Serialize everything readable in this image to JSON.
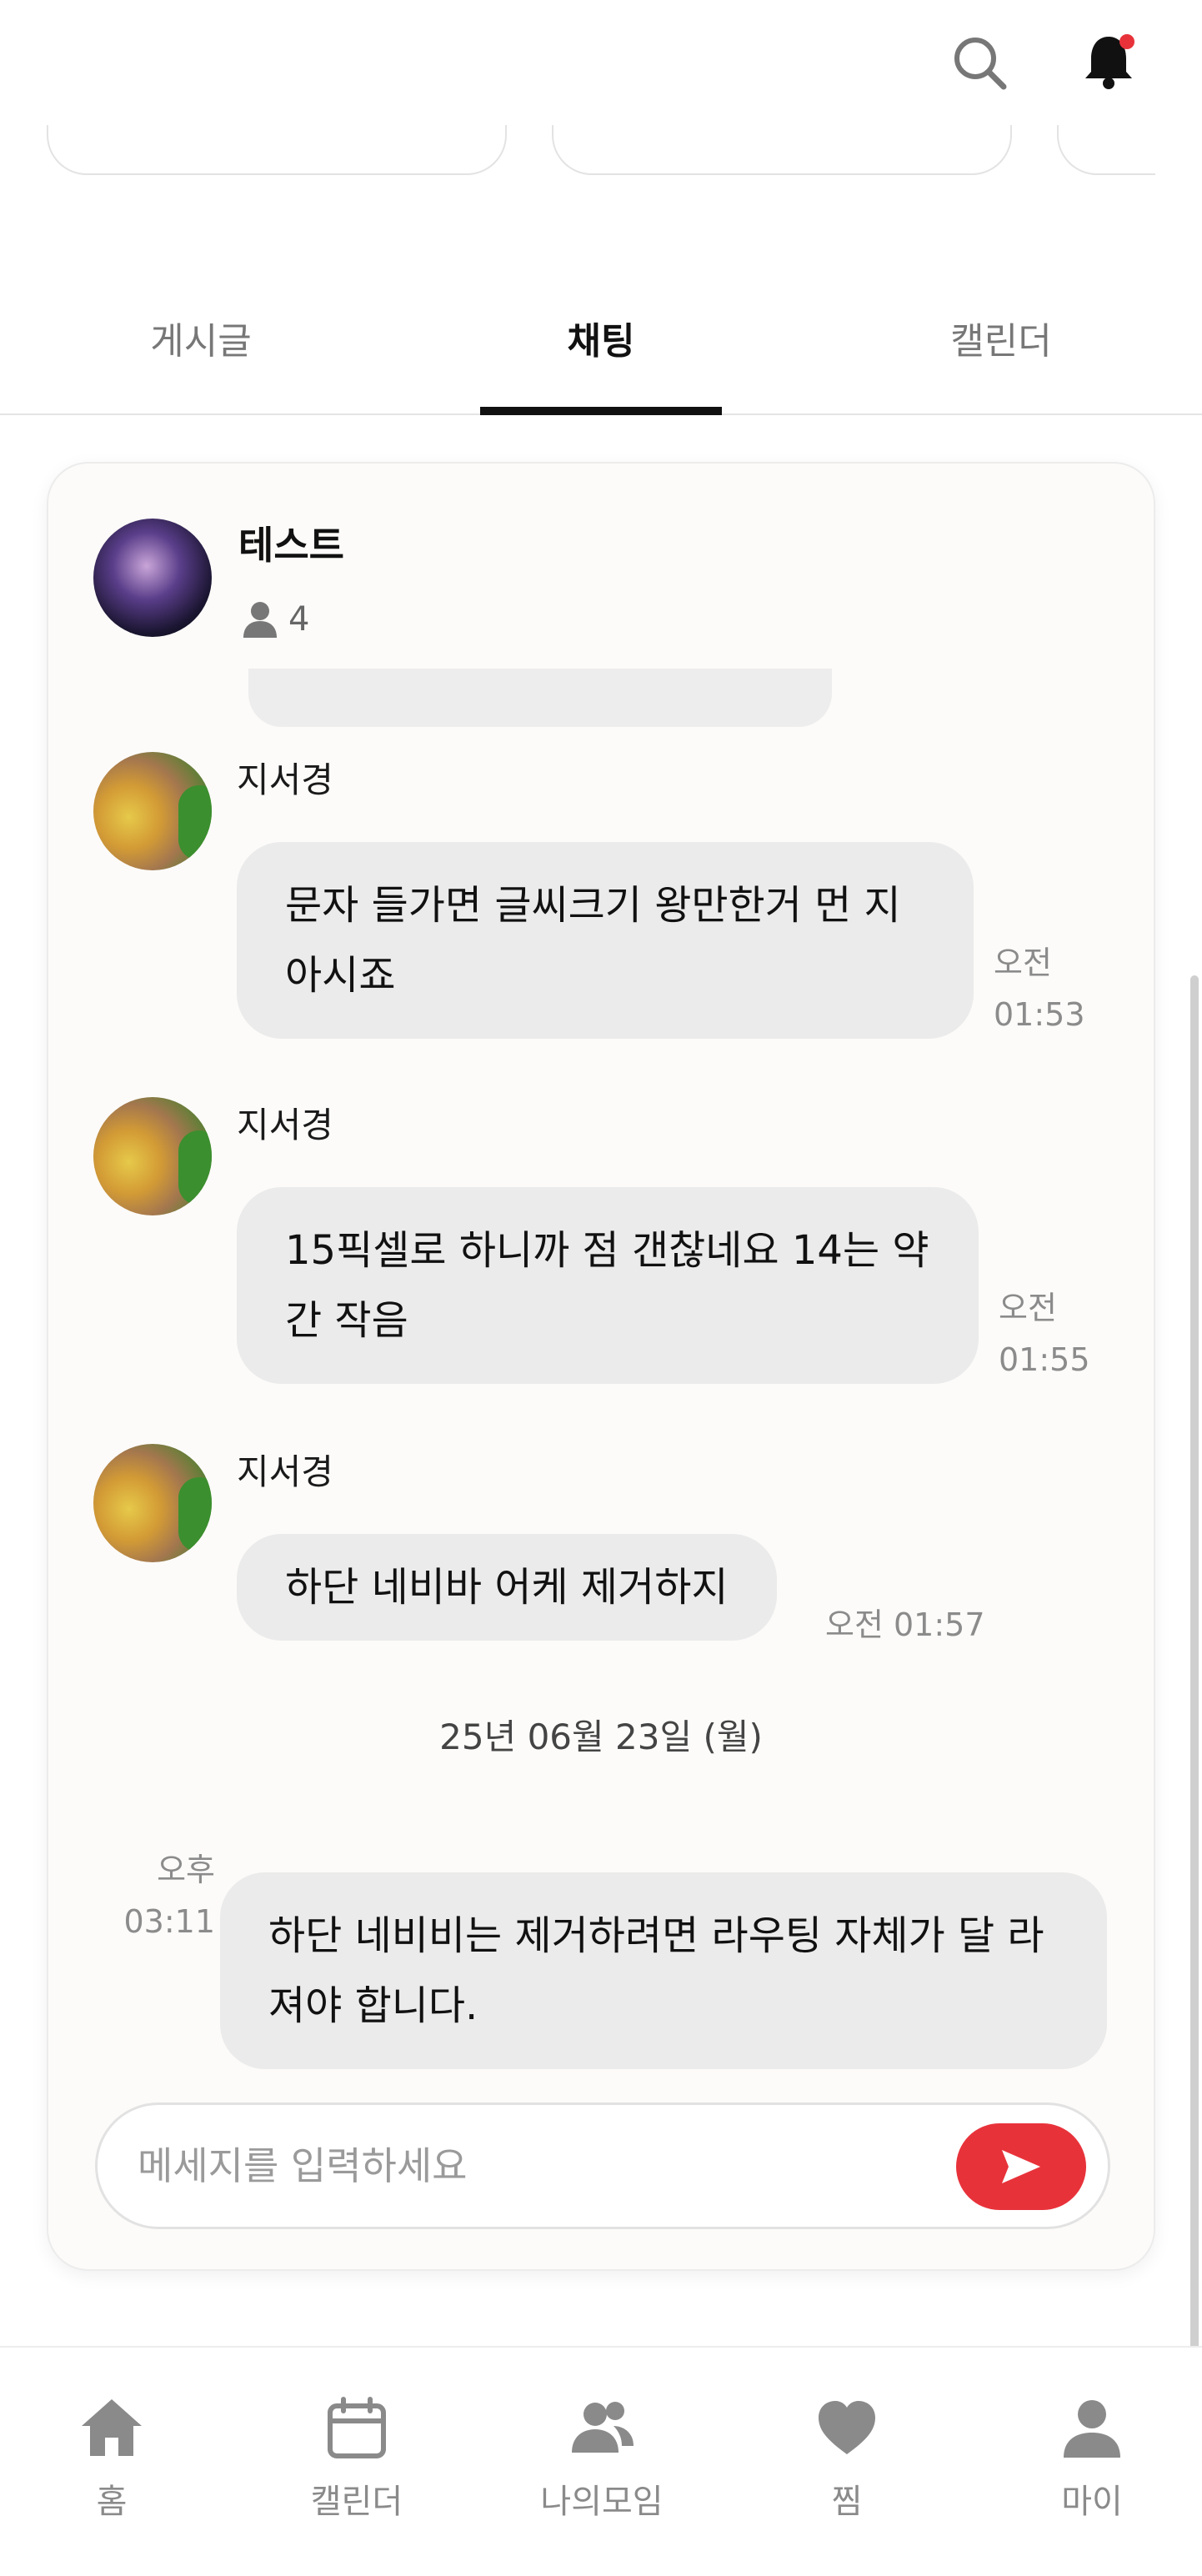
{
  "tabs": [
    {
      "label": "게시글"
    },
    {
      "label": "채팅"
    },
    {
      "label": "캘린더"
    }
  ],
  "room": {
    "title": "테스트",
    "member_count": "4"
  },
  "messages": [
    {
      "sender": "지서경",
      "text": "문자 들가면 글씨크기 왕만한거 먼 지 아시죠",
      "time_ampm": "오전",
      "time_clock": "01:53"
    },
    {
      "sender": "지서경",
      "text": "15픽셀로 하니까 점 갠찮네요 14는 약간 작음",
      "time_ampm": "오전",
      "time_clock": "01:55"
    },
    {
      "sender": "지서경",
      "text": "하단 네비바 어케 제거하지",
      "time": "오전 01:57"
    }
  ],
  "date_separator": "25년 06월 23일 (월)",
  "my_message": {
    "text": "하단 네비비는 제거하려면 라우팅 자체가 달 라져야 합니다.",
    "time_ampm": "오후",
    "time_clock": "03:11"
  },
  "composer": {
    "placeholder": "메세지를 입력하세요"
  },
  "bottom_nav": [
    {
      "label": "홈",
      "icon": "home-icon"
    },
    {
      "label": "캘린더",
      "icon": "calendar-icon"
    },
    {
      "label": "나의모임",
      "icon": "group-icon"
    },
    {
      "label": "찜",
      "icon": "heart-icon"
    },
    {
      "label": "마이",
      "icon": "person-icon"
    }
  ],
  "colors": {
    "accent": "#e8323a",
    "bubble": "#ebebeb",
    "panel": "#fcfbf9"
  }
}
